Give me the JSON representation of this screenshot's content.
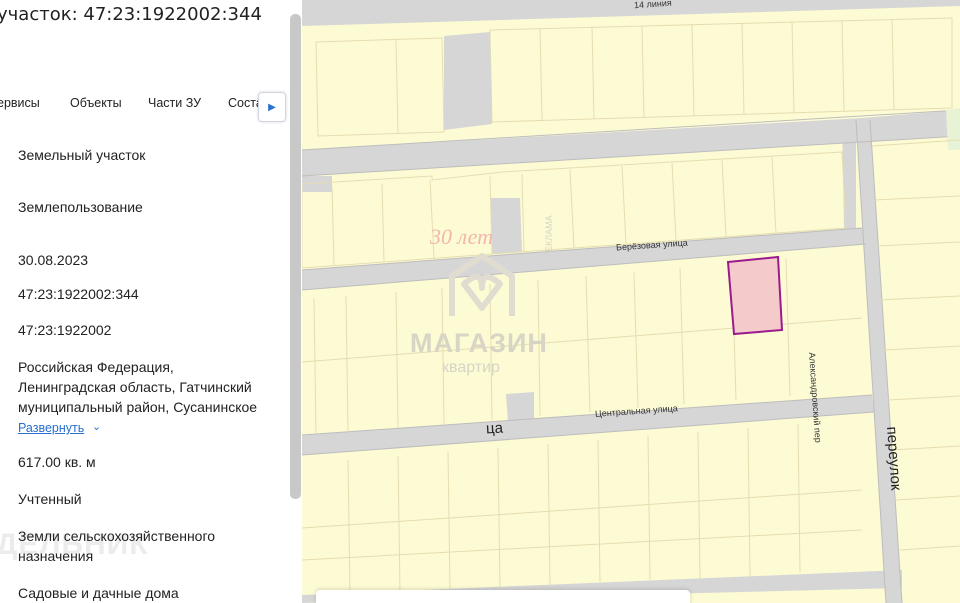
{
  "panel": {
    "title": "участок: 47:23:1922002:344",
    "tabs": [
      "ервисы",
      "Объекты",
      "Части ЗУ",
      "Соста"
    ],
    "tab_next_icon": "caret-right-icon",
    "fields": [
      "Земельный участок",
      "Землепользование",
      "30.08.2023",
      "47:23:1922002:344",
      "47:23:1922002",
      "Российская Федерация,",
      "Ленинградская область, Гатчинский",
      "муниципальный район, Сусанинское",
      "617.00 кв. м",
      "Учтенный",
      "Земли сельскохозяйственного",
      "назначения",
      "Садовые и дачные дома"
    ],
    "expand_label": "Развернуть",
    "ghost_text": "ДЕЛЬНИК"
  },
  "map": {
    "streets": {
      "line14": "14 линия",
      "berezovaya": "Берёзовая улица",
      "centralnaya": "Центральная улица",
      "tsa": "ца",
      "aleksandrovsky": "Александровский пер",
      "pereulok": "переулок"
    },
    "watermark": {
      "years": "30 лет",
      "brand": "МАГАЗИН",
      "sub": "квартир",
      "ad": "РЕКЛАМА"
    },
    "colors": {
      "parcel_fill": "#fdfbd4",
      "parcel_line": "#e5ddb0",
      "road": "#d6d6d6",
      "selected_fill": "#f5caca",
      "selected_stroke": "#9b1a8e",
      "green": "#e8f3d6"
    }
  }
}
